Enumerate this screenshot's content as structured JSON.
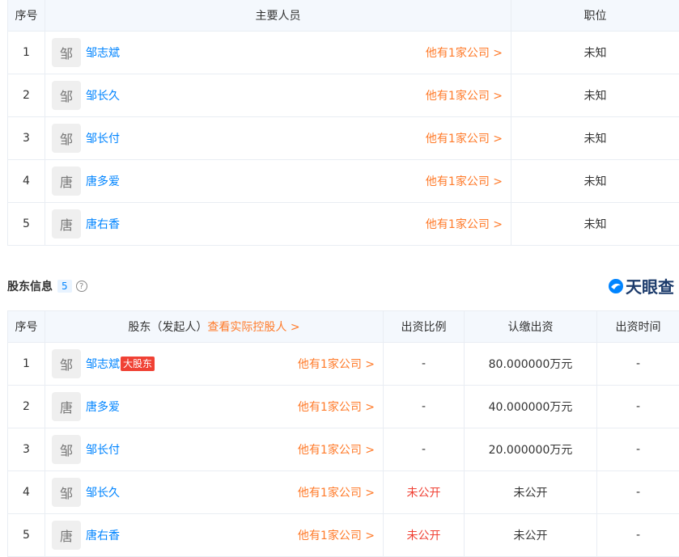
{
  "staff_table": {
    "headers": {
      "index": "序号",
      "person": "主要人员",
      "position": "职位"
    },
    "rows": [
      {
        "index": "1",
        "avatar": "邹",
        "name": "邹志斌",
        "companies": "他有1家公司 >",
        "position": "未知"
      },
      {
        "index": "2",
        "avatar": "邹",
        "name": "邹长久",
        "companies": "他有1家公司 >",
        "position": "未知"
      },
      {
        "index": "3",
        "avatar": "邹",
        "name": "邹长付",
        "companies": "他有1家公司 >",
        "position": "未知"
      },
      {
        "index": "4",
        "avatar": "唐",
        "name": "唐多爱",
        "companies": "他有1家公司 >",
        "position": "未知"
      },
      {
        "index": "5",
        "avatar": "唐",
        "name": "唐右香",
        "companies": "他有1家公司 >",
        "position": "未知"
      }
    ]
  },
  "shareholder_section": {
    "title": "股东信息",
    "count": "5",
    "help_icon": "?",
    "logo_text": "天眼查"
  },
  "shareholder_table": {
    "headers": {
      "index": "序号",
      "shareholder": "股东（发起人）",
      "controller_link": "查看实际控股人 >",
      "ratio": "出资比例",
      "subscribed": "认缴出资",
      "date": "出资时间"
    },
    "rows": [
      {
        "index": "1",
        "avatar": "邹",
        "name": "邹志斌",
        "badge": "大股东",
        "companies": "他有1家公司 >",
        "ratio": "-",
        "subscribed": "80.000000万元",
        "date": "-"
      },
      {
        "index": "2",
        "avatar": "唐",
        "name": "唐多爱",
        "badge": "",
        "companies": "他有1家公司 >",
        "ratio": "-",
        "subscribed": "40.000000万元",
        "date": "-"
      },
      {
        "index": "3",
        "avatar": "邹",
        "name": "邹长付",
        "badge": "",
        "companies": "他有1家公司 >",
        "ratio": "-",
        "subscribed": "20.000000万元",
        "date": "-"
      },
      {
        "index": "4",
        "avatar": "邹",
        "name": "邹长久",
        "badge": "",
        "companies": "他有1家公司 >",
        "ratio": "未公开",
        "subscribed": "未公开",
        "date": "-"
      },
      {
        "index": "5",
        "avatar": "唐",
        "name": "唐右香",
        "badge": "",
        "companies": "他有1家公司 >",
        "ratio": "未公开",
        "subscribed": "未公开",
        "date": "-"
      }
    ]
  },
  "colors": {
    "link": "#0084ff",
    "accent": "#ff7a29",
    "alert": "#f04134",
    "header_bg": "#f4f8fd"
  }
}
